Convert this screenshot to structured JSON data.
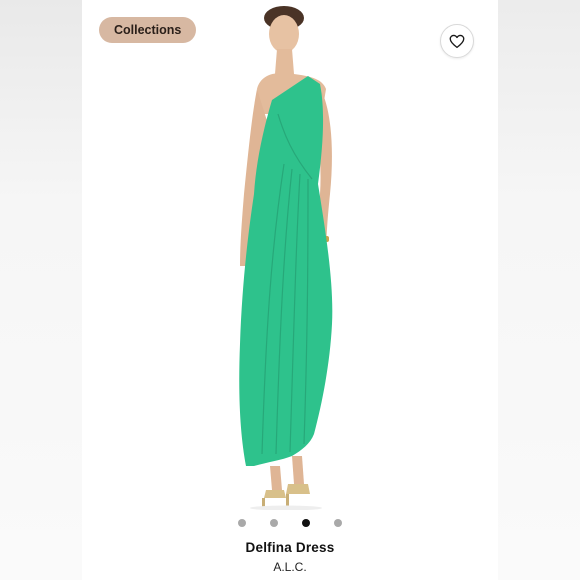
{
  "collections_chip": {
    "label": "Collections"
  },
  "favorite": {
    "icon": "heart-icon"
  },
  "image_carousel": {
    "total_images": 4,
    "active_index": 2
  },
  "product": {
    "name": "Delfina Dress",
    "brand": "A.L.C."
  },
  "colors": {
    "chip_bg": "#d7b8a2",
    "dress": "#2ec28c",
    "active_dot": "#111111",
    "inactive_dot": "#a9a9a9"
  }
}
